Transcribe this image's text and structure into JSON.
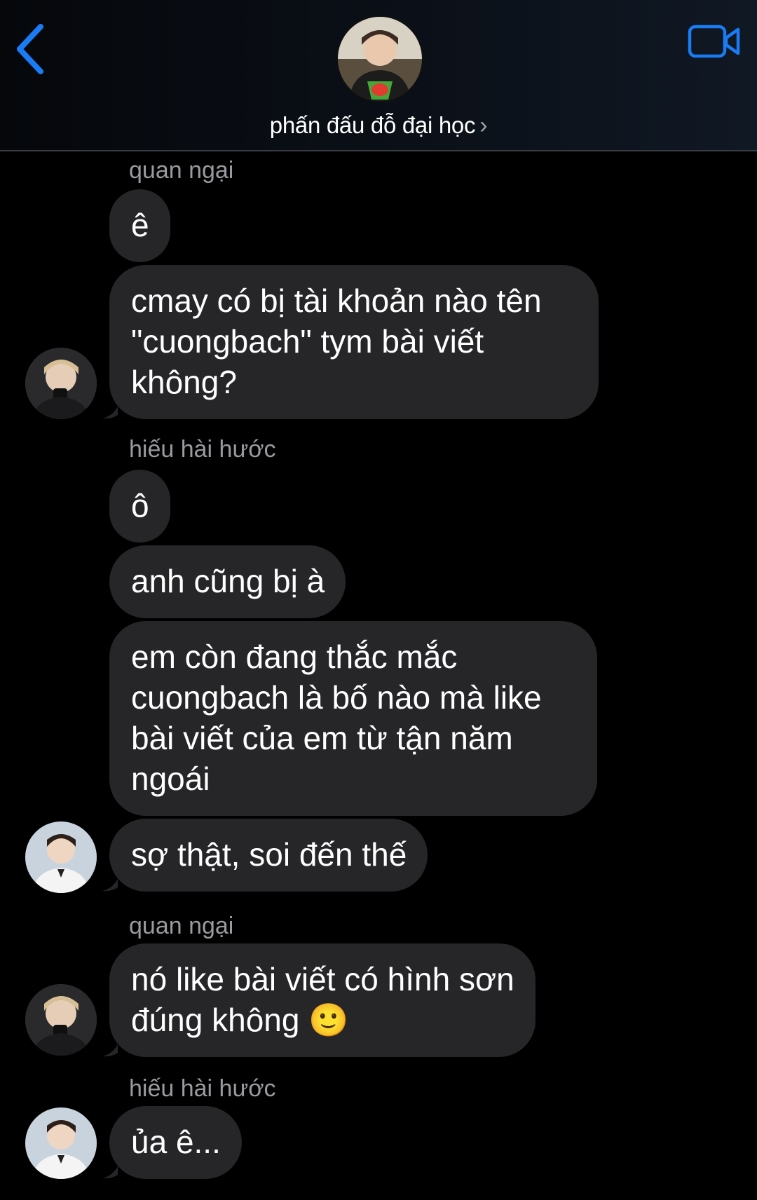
{
  "header": {
    "group_name": "phấn đấu đỗ đại học",
    "chevron": "›",
    "icons": {
      "back": "chevron-left-icon",
      "video": "video-camera-icon"
    },
    "accent_color": "#1a7cf5"
  },
  "messages": [
    {
      "sender": "quan ngại",
      "text": "ê"
    },
    {
      "text": "cmay có bị tài khoản nào tên\n\"cuongbach\" tym bài viết\nkhông?"
    },
    {
      "sender": "hiếu hài hước",
      "text": "ô"
    },
    {
      "text": "anh cũng bị à"
    },
    {
      "text": "em còn đang thắc mắc\ncuongbach là bố nào mà like\nbài viết của em từ tận năm\nngoái"
    },
    {
      "text": "sợ thật, soi đến thế"
    },
    {
      "sender": "quan ngại",
      "text": "nó like bài viết có hình sơn\nđúng không 🙂"
    },
    {
      "sender": "hiếu hài hước",
      "text": "ủa ê..."
    }
  ]
}
